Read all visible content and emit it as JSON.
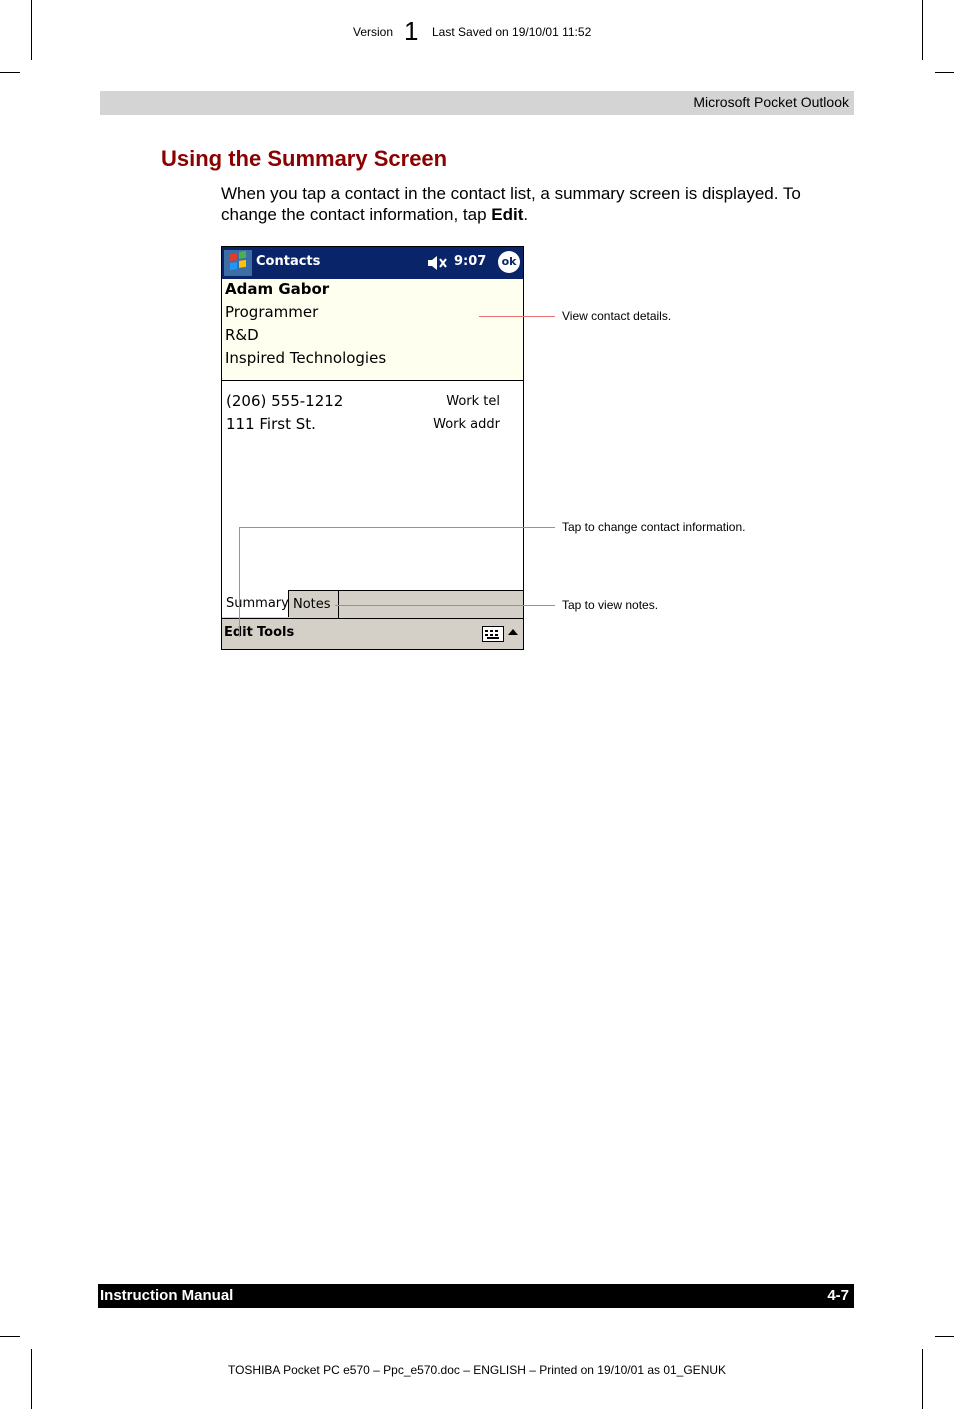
{
  "meta": {
    "version_label": "Version",
    "version_number": "1",
    "last_saved": "Last Saved on 19/10/01 11:52"
  },
  "header": {
    "chapter": "Microsoft Pocket Outlook"
  },
  "section": {
    "title": "Using the Summary Screen",
    "body_before": "When you tap a contact in the contact list, a summary screen is displayed. To change the contact information, tap ",
    "body_bold": "Edit",
    "body_after": "."
  },
  "device": {
    "app_title": "Contacts",
    "time": "9:07",
    "ok_label": "ok",
    "contact": {
      "name": "Adam Gabor",
      "line1": "Programmer",
      "line2": "R&D",
      "line3": "Inspired Technologies"
    },
    "fields": [
      {
        "value": "(206) 555-1212",
        "label": "Work tel"
      },
      {
        "value": "111 First St.",
        "label": "Work addr"
      }
    ],
    "tabs": [
      "Summary",
      "Notes"
    ],
    "menu": [
      "Edit",
      "Tools"
    ],
    "icons": {
      "start": "windows-start-icon",
      "speaker": "speaker-icon",
      "keyboard": "keyboard-icon"
    }
  },
  "callouts": [
    "View contact details.",
    "Tap to change contact information.",
    "Tap to view notes."
  ],
  "footer": {
    "left": "Instruction Manual",
    "right": "4-7",
    "print_info": "TOSHIBA Pocket PC e570  – Ppc_e570.doc – ENGLISH – Printed on 19/10/01 as 01_GENUK"
  },
  "colors": {
    "title": "#8b0000",
    "header_bar": "#d4d4d4",
    "callout_line": "#e57373",
    "device_titlebar": "#0a246a"
  }
}
